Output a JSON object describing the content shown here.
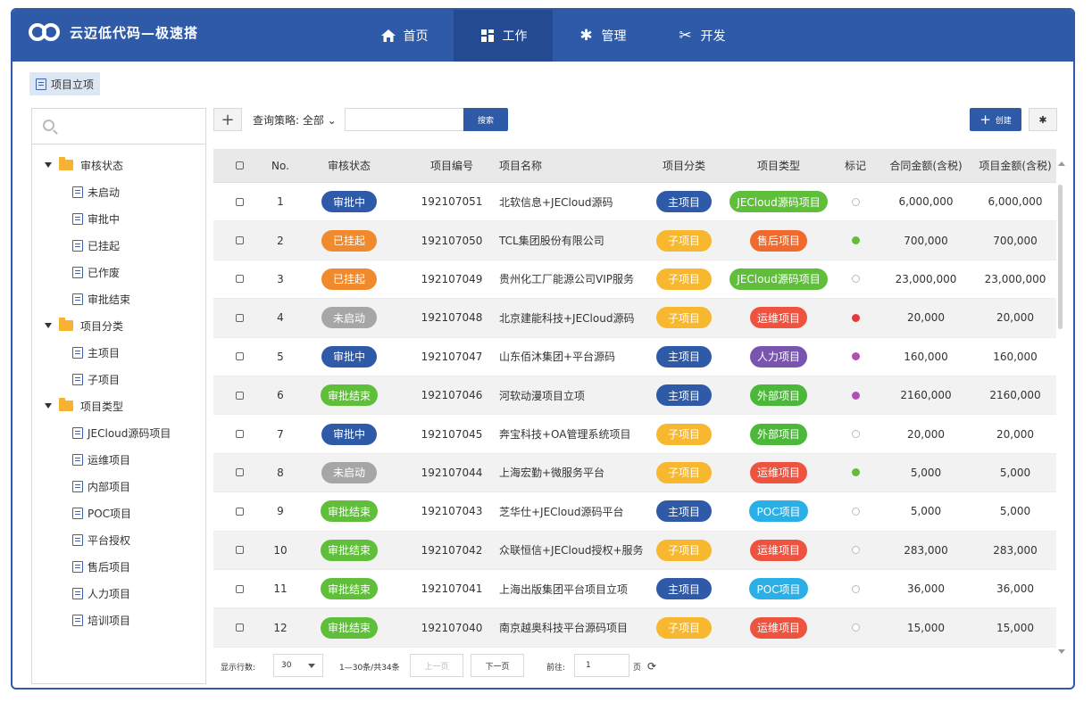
{
  "app": {
    "title": "云迈低代码—极速搭"
  },
  "nav": [
    {
      "label": "首页",
      "icon": "home-icon"
    },
    {
      "label": "工作",
      "icon": "dashboard-icon",
      "active": true
    },
    {
      "label": "管理",
      "icon": "gear-icon"
    },
    {
      "label": "开发",
      "icon": "tools-icon"
    }
  ],
  "breadcrumb": {
    "label": "项目立项"
  },
  "sidebar": {
    "groups": [
      {
        "label": "审核状态",
        "items": [
          "未启动",
          "审批中",
          "已挂起",
          "已作废",
          "审批结束"
        ]
      },
      {
        "label": "项目分类",
        "items": [
          "主项目",
          "子项目"
        ]
      },
      {
        "label": "项目类型",
        "items": [
          "JECloud源码项目",
          "运维项目",
          "内部项目",
          "POC项目",
          "平台授权",
          "售后项目",
          "人力项目",
          "培训项目"
        ]
      }
    ]
  },
  "toolbar": {
    "strategy_label": "查询策略: 全部",
    "search_value": "",
    "search_button": "搜索",
    "create_button": "创建"
  },
  "grid": {
    "columns": [
      "No.",
      "审核状态",
      "项目编号",
      "项目名称",
      "项目分类",
      "项目类型",
      "标记",
      "合同金额(含税)",
      "项目金额(含税)"
    ],
    "rows": [
      {
        "no": "1",
        "status": "审批中",
        "code": "192107051",
        "name": "北软信息+JECloud源码",
        "category": "主项目",
        "type": "JECloud源码项目",
        "mark": "",
        "contract": "6,000,000",
        "amount": "6,000,000"
      },
      {
        "no": "2",
        "status": "已挂起",
        "code": "192107050",
        "name": "TCL集团股份有限公司",
        "category": "子项目",
        "type": "售后项目",
        "mark": "green",
        "contract": "700,000",
        "amount": "700,000"
      },
      {
        "no": "3",
        "status": "已挂起",
        "code": "192107049",
        "name": "贵州化工厂能源公司VIP服务",
        "category": "子项目",
        "type": "JECloud源码项目",
        "mark": "",
        "contract": "23,000,000",
        "amount": "23,000,000"
      },
      {
        "no": "4",
        "status": "未启动",
        "code": "192107048",
        "name": "北京建能科技+JECloud源码",
        "category": "子项目",
        "type": "运维项目",
        "mark": "red",
        "contract": "20,000",
        "amount": "20,000"
      },
      {
        "no": "5",
        "status": "审批中",
        "code": "192107047",
        "name": "山东佰沐集团+平台源码",
        "category": "主项目",
        "type": "人力项目",
        "mark": "purple",
        "contract": "160,000",
        "amount": "160,000"
      },
      {
        "no": "6",
        "status": "审批结束",
        "code": "192107046",
        "name": "河软动漫项目立项",
        "category": "主项目",
        "type": "外部项目",
        "mark": "purple",
        "contract": "2160,000",
        "amount": "2160,000"
      },
      {
        "no": "7",
        "status": "审批中",
        "code": "192107045",
        "name": "奔宝科技+OA管理系统项目",
        "category": "子项目",
        "type": "外部项目",
        "mark": "",
        "contract": "20,000",
        "amount": "20,000"
      },
      {
        "no": "8",
        "status": "未启动",
        "code": "192107044",
        "name": "上海宏勤+微服务平台",
        "category": "子项目",
        "type": "运维项目",
        "mark": "green",
        "contract": "5,000",
        "amount": "5,000"
      },
      {
        "no": "9",
        "status": "审批结束",
        "code": "192107043",
        "name": "芝华仕+JECloud源码平台",
        "category": "主项目",
        "type": "POC项目",
        "mark": "",
        "contract": "5,000",
        "amount": "5,000"
      },
      {
        "no": "10",
        "status": "审批结束",
        "code": "192107042",
        "name": "众联恒信+JECloud授权+服务",
        "category": "子项目",
        "type": "运维项目",
        "mark": "",
        "contract": "283,000",
        "amount": "283,000"
      },
      {
        "no": "11",
        "status": "审批结束",
        "code": "192107041",
        "name": "上海出版集团平台项目立项",
        "category": "主项目",
        "type": "POC项目",
        "mark": "",
        "contract": "36,000",
        "amount": "36,000"
      },
      {
        "no": "12",
        "status": "审批结束",
        "code": "192107040",
        "name": "南京越奥科技平台源码项目",
        "category": "子项目",
        "type": "运维项目",
        "mark": "",
        "contract": "15,000",
        "amount": "15,000"
      }
    ]
  },
  "pager": {
    "rows_label": "显示行数:",
    "rows_value": "30",
    "range_text": "1—30条/共34条",
    "prev": "上一页",
    "next": "下一页",
    "goto_label": "前往:",
    "page_value": "1",
    "page_unit": "页"
  },
  "colors": {
    "brand": "#2f5aa8",
    "status": {
      "审批中": "#2f5aa8",
      "已挂起": "#f08a2c",
      "未启动": "#a6a6a6",
      "审批结束": "#5fbf3b"
    },
    "category": {
      "主项目": "#2f5aa8",
      "子项目": "#f7b72e"
    },
    "type": {
      "JECloud源码项目": "#5fbf3b",
      "售后项目": "#f06a2c",
      "运维项目": "#ee5340",
      "人力项目": "#7a55b0",
      "外部项目": "#4cb83a",
      "POC项目": "#2ab0e6"
    },
    "mark": {
      "green": "#5fbf3b",
      "red": "#e53935",
      "purple": "#b04fb8"
    }
  }
}
